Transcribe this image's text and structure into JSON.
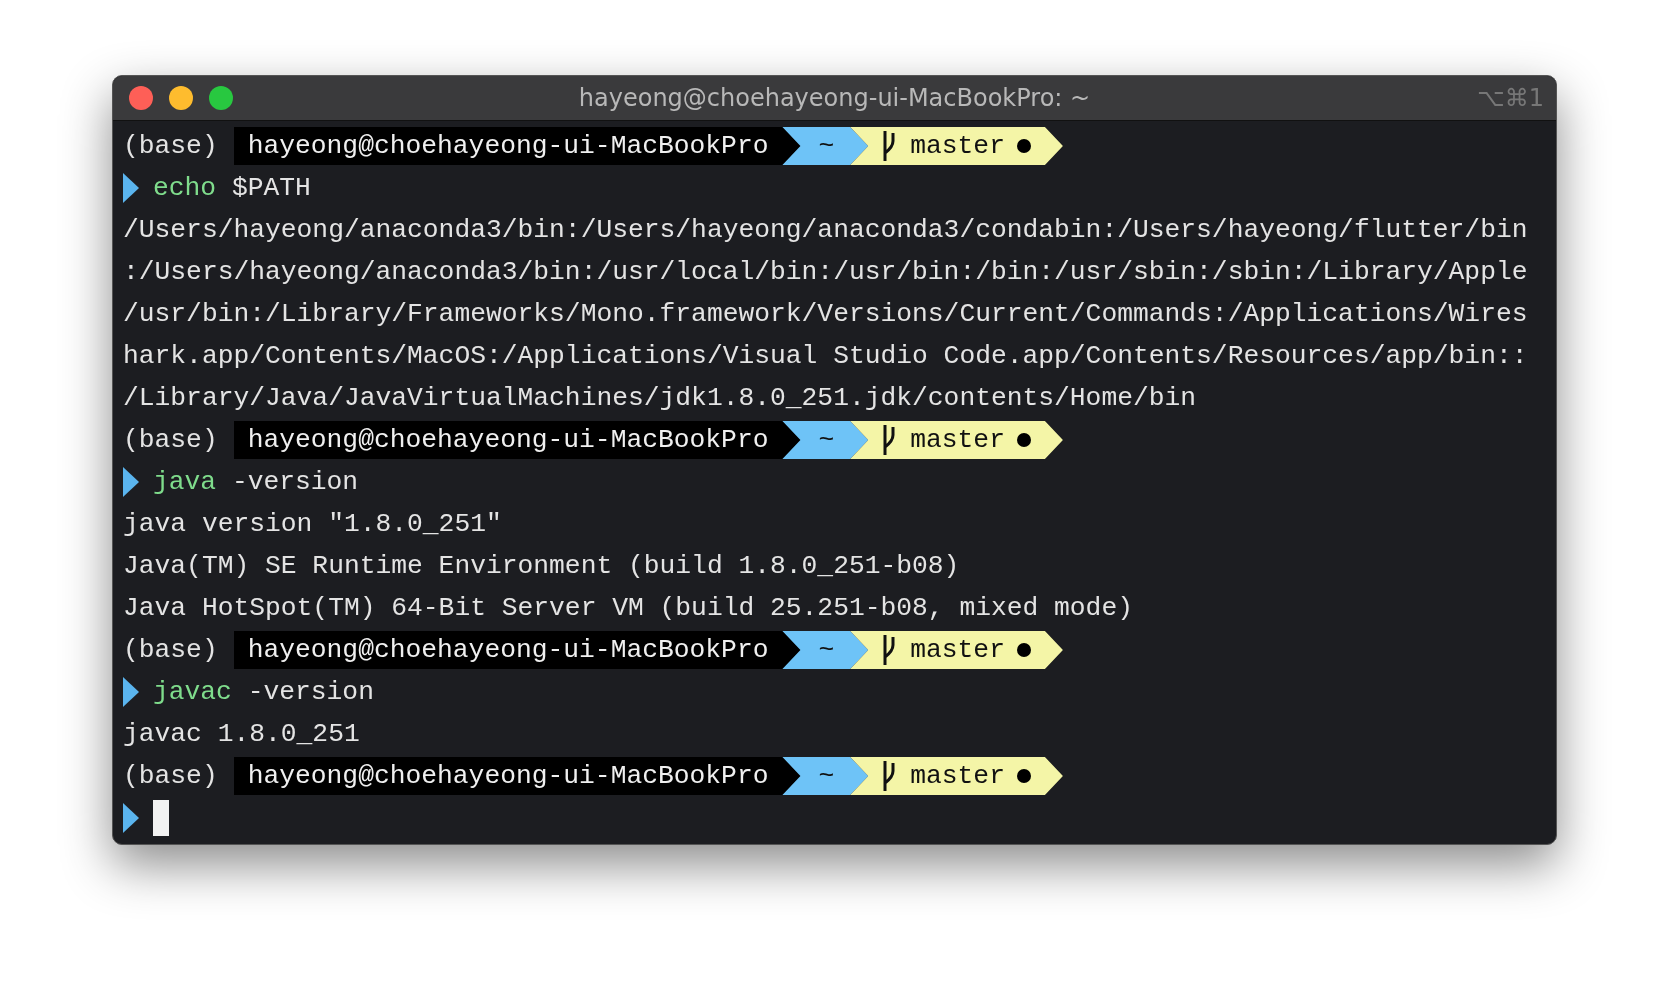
{
  "window": {
    "title": "hayeong@choehayeong-ui-MacBookPro: ~",
    "shortcut": "⌥⌘1"
  },
  "lines": [
    {
      "kind": "prompt",
      "env": "(base)",
      "user_host": "hayeong@choehayeong-ui-MacBookPro",
      "dir": "~",
      "branch": "master"
    },
    {
      "kind": "command",
      "command": "echo",
      "args": " $PATH"
    },
    {
      "kind": "output",
      "text": "/Users/hayeong/anaconda3/bin:/Users/hayeong/anaconda3/condabin:/Users/hayeong/flutter/bin"
    },
    {
      "kind": "output",
      "text": ":/Users/hayeong/anaconda3/bin:/usr/local/bin:/usr/bin:/bin:/usr/sbin:/sbin:/Library/Apple"
    },
    {
      "kind": "output",
      "text": "/usr/bin:/Library/Frameworks/Mono.framework/Versions/Current/Commands:/Applications/Wires"
    },
    {
      "kind": "output",
      "text": "hark.app/Contents/MacOS:/Applications/Visual Studio Code.app/Contents/Resources/app/bin::"
    },
    {
      "kind": "output",
      "text": "/Library/Java/JavaVirtualMachines/jdk1.8.0_251.jdk/contents/Home/bin"
    },
    {
      "kind": "prompt",
      "env": "(base)",
      "user_host": "hayeong@choehayeong-ui-MacBookPro",
      "dir": "~",
      "branch": "master"
    },
    {
      "kind": "command",
      "command": "java",
      "args": " -version"
    },
    {
      "kind": "output",
      "text": "java version \"1.8.0_251\""
    },
    {
      "kind": "output",
      "text": "Java(TM) SE Runtime Environment (build 1.8.0_251-b08)"
    },
    {
      "kind": "output",
      "text": "Java HotSpot(TM) 64-Bit Server VM (build 25.251-b08, mixed mode)"
    },
    {
      "kind": "prompt",
      "env": "(base)",
      "user_host": "hayeong@choehayeong-ui-MacBookPro",
      "dir": "~",
      "branch": "master"
    },
    {
      "kind": "command",
      "command": "javac",
      "args": " -version"
    },
    {
      "kind": "output",
      "text": "javac 1.8.0_251"
    },
    {
      "kind": "prompt",
      "env": "(base)",
      "user_host": "hayeong@choehayeong-ui-MacBookPro",
      "dir": "~",
      "branch": "master"
    },
    {
      "kind": "input"
    }
  ]
}
